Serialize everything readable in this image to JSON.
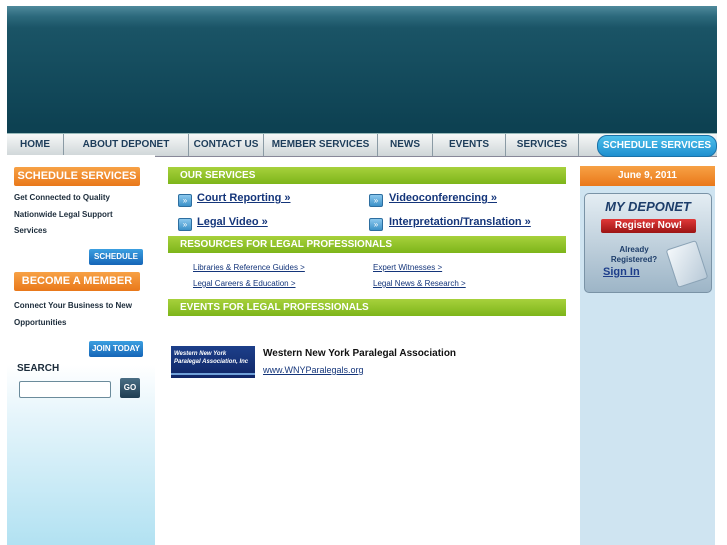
{
  "nav": {
    "items": [
      "HOME",
      "ABOUT DEPONET",
      "CONTACT US",
      "MEMBER SERVICES",
      "NEWS",
      "EVENTS",
      "SERVICES"
    ],
    "active": "SCHEDULE SERVICES"
  },
  "left": {
    "schedule_header": "SCHEDULE SERVICES",
    "schedule_text_1": "Get Connected to Quality",
    "schedule_text_2": "Nationwide Legal Support",
    "schedule_text_3": "Services",
    "schedule_button": "SCHEDULE",
    "member_header": "BECOME A MEMBER",
    "member_text_1": "Connect Your Business to New",
    "member_text_2": "Opportunities",
    "member_button": "JOIN TODAY",
    "search_label": "SEARCH",
    "search_value": "",
    "go_button": "GO"
  },
  "main": {
    "services_header": "OUR SERVICES",
    "services": [
      "Court Reporting »",
      "Videoconferencing »",
      "Legal Video »",
      "Interpretation/Translation »"
    ],
    "resources_header": "RESOURCES FOR LEGAL PROFESSIONALS",
    "resources": [
      "Libraries & Reference Guides >",
      "Expert Witnesses >",
      "Legal Careers & Education >",
      "Legal News & Research >"
    ],
    "events_header": "EVENTS FOR LEGAL PROFESSIONALS",
    "event_logo_text_1": "Western New York",
    "event_logo_text_2": "Paralegal Association, Inc",
    "event_title": "Western New York Paralegal Association",
    "event_link": "www.WNYParalegals.org"
  },
  "right": {
    "date": "June 9, 2011",
    "mydeponet_title": "MY DEPONET",
    "register": "Register Now!",
    "already_1": "Already",
    "already_2": "Registered?",
    "sign_in": "Sign In"
  }
}
